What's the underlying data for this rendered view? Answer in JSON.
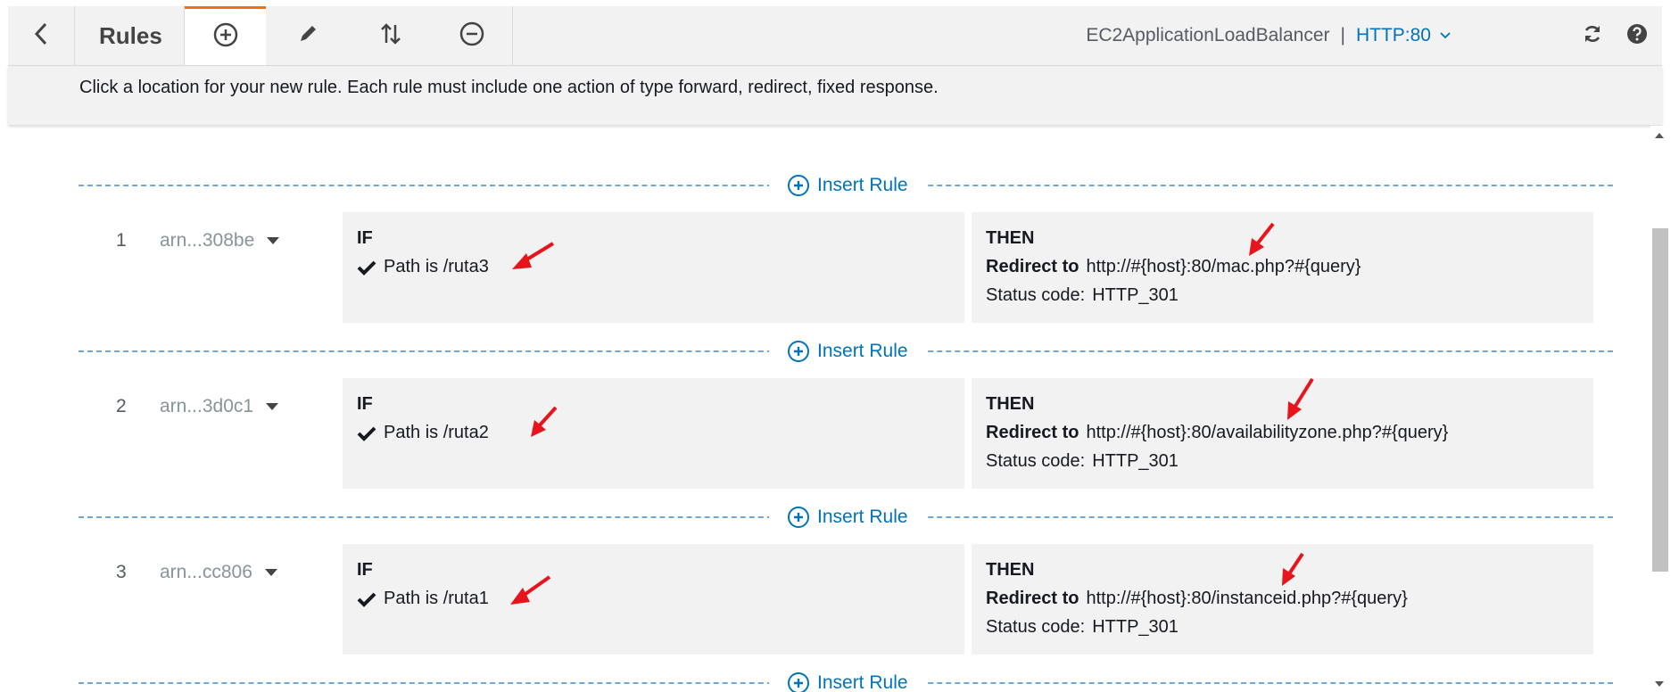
{
  "toolbar": {
    "back_icon": "chevron-left-icon",
    "title": "Rules",
    "add_icon": "plus-circle-icon",
    "edit_icon": "pencil-icon",
    "reorder_icon": "sort-arrows-icon",
    "delete_icon": "minus-circle-icon",
    "load_balancer": "EC2ApplicationLoadBalancer",
    "separator": "|",
    "listener": "HTTP:80",
    "refresh_icon": "refresh-icon",
    "help_icon": "help-icon"
  },
  "info": {
    "message": "Click a location for your new rule. Each rule must include one action of type forward, redirect, fixed response."
  },
  "insert_label": "Insert Rule",
  "rules": [
    {
      "number": "1",
      "arn": "arn...308be",
      "if_label": "IF",
      "condition_key": "Path is",
      "condition_value": "/ruta3",
      "then_label": "THEN",
      "action_label": "Redirect to",
      "action_value": "http://#{host}:80/mac.php?#{query}",
      "status_label": "Status code:",
      "status_value": "HTTP_301"
    },
    {
      "number": "2",
      "arn": "arn...3d0c1",
      "if_label": "IF",
      "condition_key": "Path is",
      "condition_value": "/ruta2",
      "then_label": "THEN",
      "action_label": "Redirect to",
      "action_value": "http://#{host}:80/availabilityzone.php?#{query}",
      "status_label": "Status code:",
      "status_value": "HTTP_301"
    },
    {
      "number": "3",
      "arn": "arn...cc806",
      "if_label": "IF",
      "condition_key": "Path is",
      "condition_value": "/ruta1",
      "then_label": "THEN",
      "action_label": "Redirect to",
      "action_value": "http://#{host}:80/instanceid.php?#{query}",
      "status_label": "Status code:",
      "status_value": "HTTP_301"
    }
  ],
  "colors": {
    "accent": "#ec7211",
    "link": "#0073bb",
    "annotation_arrow": "#e8141c"
  }
}
